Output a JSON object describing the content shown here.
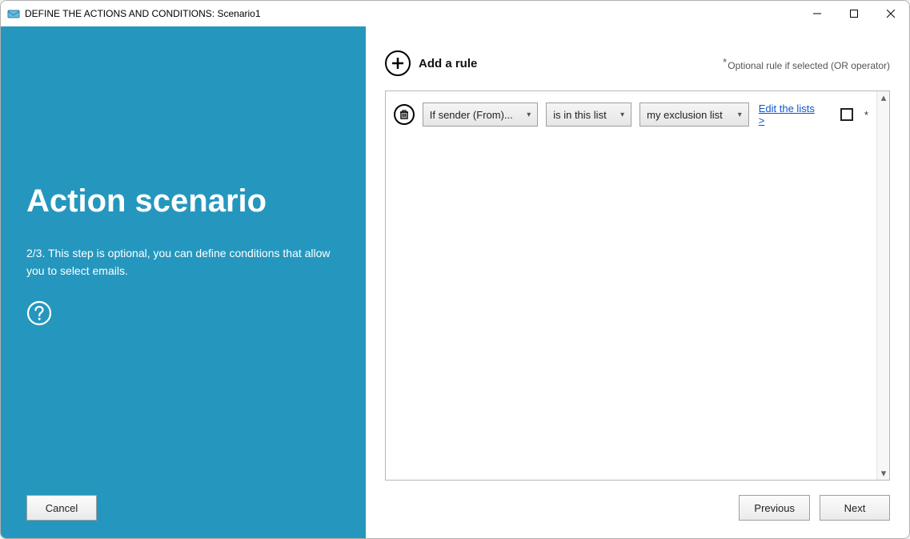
{
  "window": {
    "title": "DEFINE THE ACTIONS AND CONDITIONS: Scenario1"
  },
  "sidebar": {
    "heading": "Action scenario",
    "description": "2/3. This step is optional, you can define conditions that allow you to select emails.",
    "cancel_label": "Cancel"
  },
  "main": {
    "add_rule_label": "Add a rule",
    "optional_note": "Optional rule if selected (OR operator)",
    "rule": {
      "field": "If sender (From)...",
      "operator": "is in this list",
      "value": "my exclusion list",
      "edit_link": "Edit the lists >",
      "optional_marker": "*"
    },
    "previous_label": "Previous",
    "next_label": "Next"
  }
}
